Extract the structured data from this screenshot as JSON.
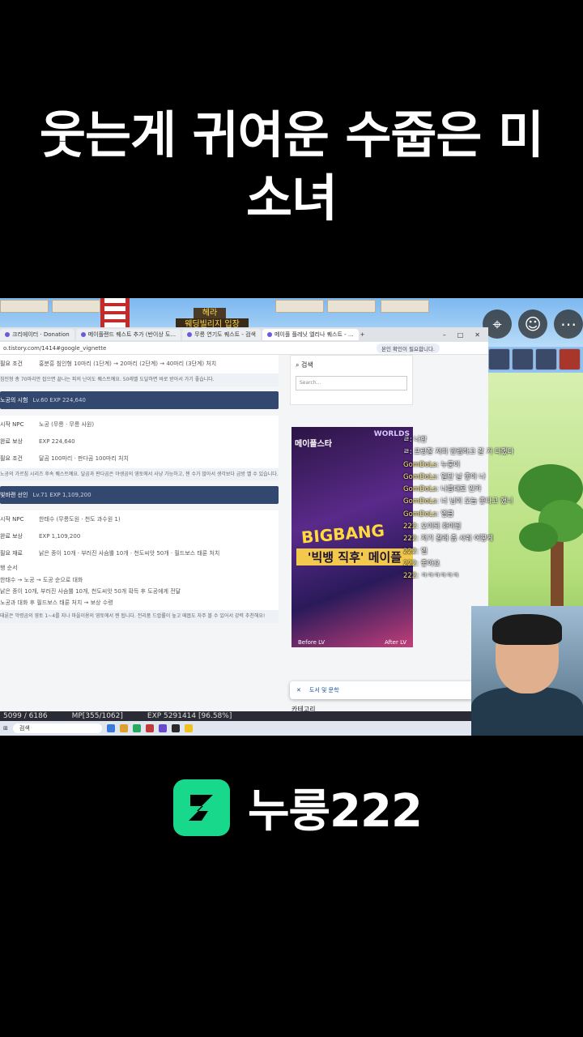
{
  "headline": {
    "line1": "웃는게 귀여운 수줍은 미",
    "line2": "소녀"
  },
  "game": {
    "npc_name": "헤라",
    "portal_sign": "웨딩빌리지 입장",
    "status": {
      "hp": "5099 / 6186",
      "mp": "MP[355/1062]",
      "exp": "EXP 5291414 [96.58%]"
    },
    "chat": [
      {
        "name": "",
        "text": "ㄹ: 나한"
      },
      {
        "name": "",
        "text": "ㄹ: 프랑잘 저희 만렙하고 갈 거 다했다"
      },
      {
        "name": "GomDoLs",
        "text": ": 누룽이"
      },
      {
        "name": "GomDoLs",
        "text": ": 일단 날 좋아 나"
      },
      {
        "name": "GomDoLs",
        "text": ": 나름대로 인카"
      },
      {
        "name": "GomDoLs",
        "text": ": 너 님이 오늘 좋다고 했니"
      },
      {
        "name": "GomDoLs",
        "text": ": 엘클"
      },
      {
        "name": "222",
        "text": ": 오이되 화이팅"
      },
      {
        "name": "222",
        "text": ": 저기 갈래 좀 사줘 어떻게"
      },
      {
        "name": "222",
        "text": ": 엘"
      },
      {
        "name": "222",
        "text": ": 좋아요"
      },
      {
        "name": "222",
        "text": ": ㅋㅋㅋㅋㅋㅋ"
      }
    ]
  },
  "browser": {
    "tabs": [
      {
        "label": "크리에이터 · Donation"
      },
      {
        "label": "메이플랜드 퀘스트 추가 (반이상 도..."
      },
      {
        "label": "무릉 연기도 퀘스트 - 검색"
      },
      {
        "label": "메이플 플레닛 엘리나 퀘스트 - ..."
      }
    ],
    "url": "o.tistory.com/1414#google_vignette",
    "site_button": "본인 확인이 필요합니다.",
    "sidebar": {
      "search_title": "검색",
      "search_placeholder": "Search...",
      "ad": {
        "logo": "메이플스타",
        "worlds": "WORLDS",
        "bigbang": "BIGBANG",
        "sub": "'빅뱅 직후' 메이플",
        "before": "Before  LV",
        "after": "After  LV"
      },
      "toast": "도서 및 문학",
      "category": "카테고리"
    },
    "quests": [
      {
        "rows": [
          {
            "k": "필요 조건",
            "v": "홍분흥 침인형 10마리 (1단계) → 20마리 (2단계) → 40마리 (3단계) 처치"
          }
        ],
        "note": "침인형 총 70마리만 잡으면 끝나는 피의 난이도 퀘스트예요. 50레벨 도달하면 바로 받아서 가기 좋습니다."
      },
      {
        "title": "노공의 시험",
        "lv": "Lv.60   EXP 224,640",
        "rows": [
          {
            "k": "시작 NPC",
            "v": "노공 (무릉 · 무릉 사원)"
          },
          {
            "k": "완료 보상",
            "v": "EXP 224,640"
          },
          {
            "k": "필요 조건",
            "v": "달곰 100마리 · 판다곰 100마리 처치"
          }
        ],
        "note": "노공의 가르침 시리즈 후속 퀘스트예요. 달곰과 판다곰은 야생곰의 영토에서 사냥 가능하고, 젠 수가 많아서 생각보다 금방 깰 수 있습니다."
      },
      {
        "title": "빛바랜 선인",
        "lv": "Lv.71   EXP 1,109,200",
        "rows": [
          {
            "k": "시작 NPC",
            "v": "한태수 (무릉도원 · 천도 과수원 1)"
          },
          {
            "k": "완료 보상",
            "v": "EXP 1,109,200"
          },
          {
            "k": "필요 재료",
            "v": "낡은 종이 10개 · 부러진 사슴뿔 10개 · 천도씨앗 50개 · 필드보스 태룬 처치"
          }
        ],
        "order_title": "행 순서",
        "order": [
          "한태수 → 노공 → 도공 순으로 대화",
          "낡은 종이 10개, 부러진 사슴뿔 10개, 천도씨앗 50개 확득 후 도공에게 전달",
          "노공과 대화 후 필드보스 태룬 처치 → 보상 수령"
        ],
        "note": "태룬은 악령곰의 영토 1~4를 지나 마을이용의 영토에서 젠 됩니다. 전리품 드랍률이 높고 떼몹도 자주 볼 수 있어서 강력 추천해요!"
      }
    ]
  },
  "taskbar": {
    "search": "검색"
  },
  "brand": {
    "name": "누룽222"
  }
}
